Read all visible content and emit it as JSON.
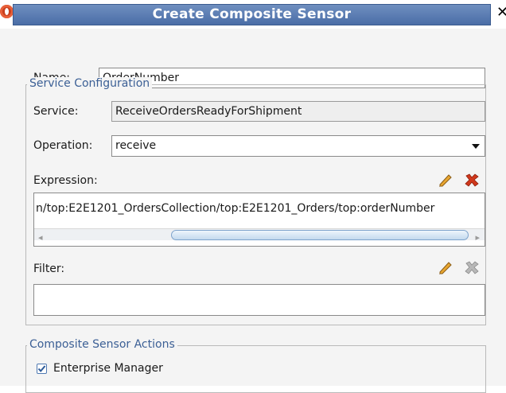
{
  "window": {
    "title": "Create Composite Sensor"
  },
  "name": {
    "label": "Name:",
    "value": "OrderNumber"
  },
  "service_configuration": {
    "legend": "Service Configuration",
    "service_label": "Service:",
    "service_value": "ReceiveOrdersReadyForShipment",
    "operation_label": "Operation:",
    "operation_value": "receive",
    "expression_label": "Expression:",
    "expression_value": "n/top:E2E1201_OrdersCollection/top:E2E1201_Orders/top:orderNumber",
    "filter_label": "Filter:",
    "filter_value": ""
  },
  "actions": {
    "legend": "Composite Sensor Actions",
    "enterprise_manager_label": "Enterprise Manager",
    "enterprise_manager_checked": true
  },
  "colors": {
    "title_bar": "#4a6da6",
    "legend_text": "#3b5f95",
    "delete_red": "#d0381c"
  }
}
